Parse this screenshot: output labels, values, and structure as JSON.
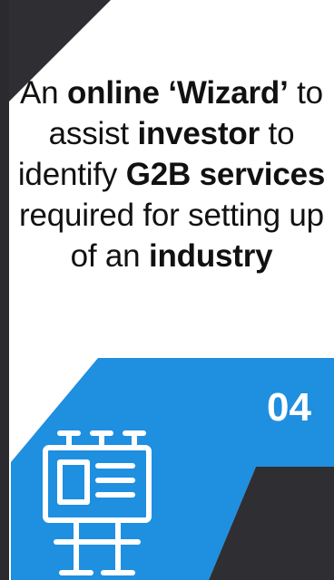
{
  "card": {
    "colors": {
      "background": "#2e2e33",
      "card": "#ffffff",
      "accent": "#1f8fe0",
      "text": "#111111",
      "number": "#ffffff"
    },
    "text": {
      "p1": "An ",
      "b1": "online ‘Wizard’",
      "p2": " to assist ",
      "b2": "investor",
      "p3": " to identify ",
      "b3": "G2B services",
      "p4": " required for setting up of an ",
      "b4": "industry"
    },
    "step_number": "04",
    "icon": "billboard-icon"
  }
}
